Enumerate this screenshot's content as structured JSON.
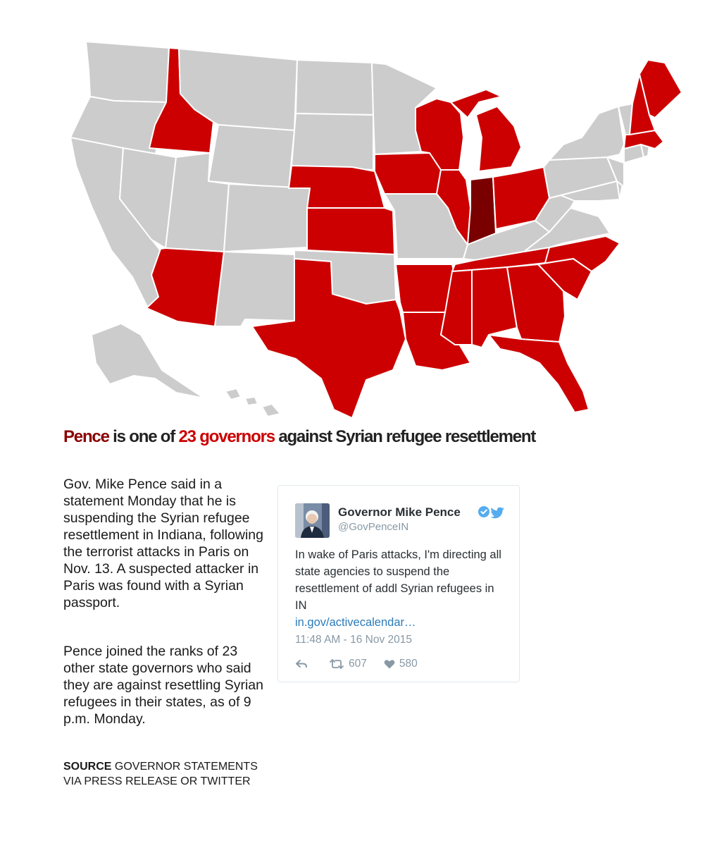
{
  "map": {
    "categories": {
      "indiana": {
        "color": "#7a0000",
        "states": [
          "Indiana"
        ]
      },
      "against": {
        "color": "#cc0000",
        "states": [
          "Idaho",
          "Arizona",
          "Texas",
          "Nebraska",
          "Kansas",
          "Iowa",
          "Arkansas",
          "Louisiana",
          "Mississippi",
          "Alabama",
          "Georgia",
          "Florida",
          "South Carolina",
          "North Carolina",
          "Tennessee",
          "Illinois",
          "Wisconsin",
          "Michigan",
          "Ohio",
          "Maine",
          "New Hampshire",
          "Massachusetts"
        ]
      },
      "other": {
        "color": "#cccccc"
      }
    }
  },
  "headline": {
    "part1": "Pence",
    "part2": " is one of ",
    "part3": "23 governors",
    "part4": " against Syrian refugee resettlement"
  },
  "body": {
    "paragraph1": "Gov. Mike Pence said in a statement Monday that he is suspending the Syrian refugee resettlement in Indiana, following the terrorist attacks in Paris on Nov. 13. A suspected attacker in Paris was found with a Syrian passport.",
    "paragraph2": "Pence joined the ranks of 23 other state governors who said they are against resettling Syrian refugees in their states, as of 9 p.m. Monday.",
    "source_label": "SOURCE",
    "source_text": " GOVERNOR STATEMENTS VIA PRESS RELEASE OR TWITTER"
  },
  "tweet": {
    "name": "Governor Mike Pence",
    "handle": "@GovPenceIN",
    "text": "In wake of Paris attacks, I'm directing all state agencies to suspend the resettlement of addl Syrian refugees in IN",
    "link": "in.gov/activecalendar…",
    "timestamp": "11:48 AM - 16 Nov 2015",
    "retweets": "607",
    "likes": "580",
    "icons": [
      "reply-icon",
      "retweet-icon",
      "heart-icon",
      "verified-icon",
      "twitter-bird-icon"
    ],
    "link_color": "#2b7bb9"
  }
}
